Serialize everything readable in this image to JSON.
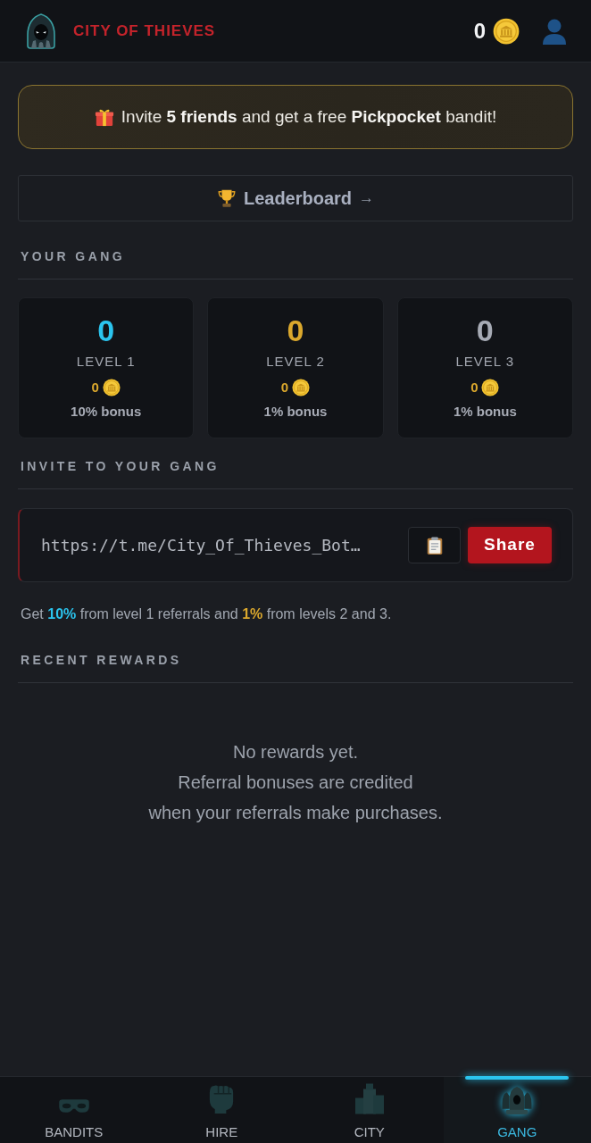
{
  "header": {
    "title": "CITY OF THIEVES",
    "coins": "0"
  },
  "promo": {
    "text": "Invite **5 friends** and get a free **Pickpocket** bandit!"
  },
  "leaderboard": {
    "label": "Leaderboard",
    "arrow": "→"
  },
  "your_gang": {
    "heading": "YOUR GANG",
    "levels": [
      {
        "count": "0",
        "label": "LEVEL 1",
        "coins": "0",
        "bonus": "10% bonus",
        "color": "#2bc4ee"
      },
      {
        "count": "0",
        "label": "LEVEL 2",
        "coins": "0",
        "bonus": "1% bonus",
        "color": "#dba82d"
      },
      {
        "count": "0",
        "label": "LEVEL 3",
        "coins": "0",
        "bonus": "1% bonus",
        "color": "#a7abb5"
      }
    ]
  },
  "invite": {
    "heading": "INVITE TO YOUR GANG",
    "link": "https://t.me/City_Of_Thieves_Bot…",
    "share_label": "Share",
    "note": "Get **10%** from level 1 referrals and **1%** from levels 2 and 3."
  },
  "recent_rewards": {
    "heading": "RECENT REWARDS",
    "empty_title": "No rewards yet.",
    "empty_lines": [
      "Referral bonuses are credited",
      "when your referrals make purchases."
    ]
  },
  "bottom_nav": [
    {
      "label": "BANDITS",
      "kind": "mask",
      "selected": false
    },
    {
      "label": "HIRE",
      "kind": "fist",
      "selected": false
    },
    {
      "label": "CITY",
      "kind": "buildings",
      "selected": false
    },
    {
      "label": "GANG",
      "kind": "hoods",
      "selected": true
    }
  ]
}
